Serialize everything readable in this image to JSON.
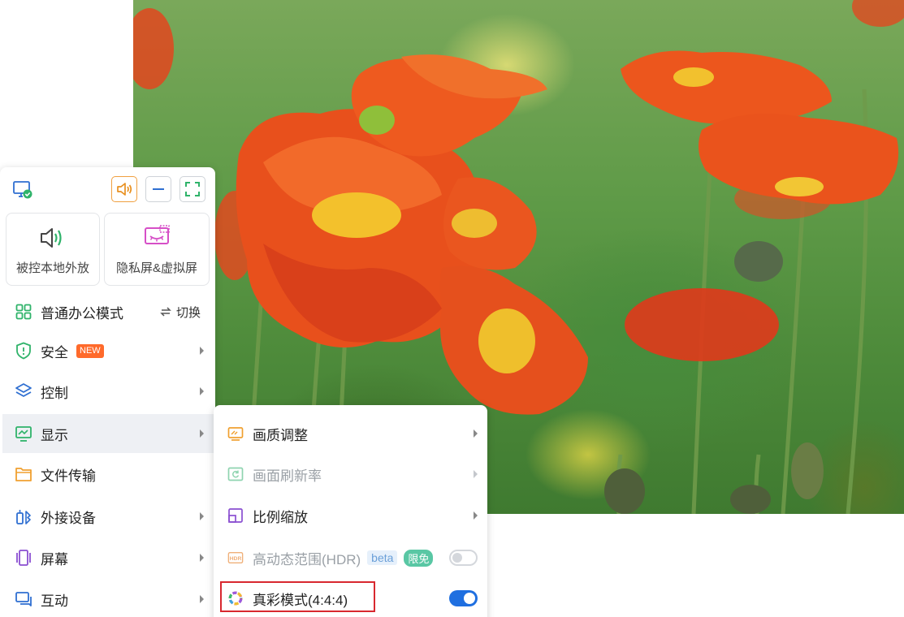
{
  "colors": {
    "accent_blue": "#1f6fe0",
    "accent_green": "#2fb36a",
    "accent_orange": "#ff6a2b",
    "highlight_red": "#d8282f"
  },
  "toolbar": {
    "icons": [
      "monitor-check-icon",
      "speaker-icon",
      "minimize-icon",
      "fullscreen-icon"
    ]
  },
  "tiles": [
    {
      "label": "被控本地外放",
      "icon": "speaker-icon"
    },
    {
      "label": "隐私屏&虚拟屏",
      "icon": "privacy-screen-icon"
    }
  ],
  "menu": {
    "mode": {
      "label": "普通办公模式",
      "switch_label": "切换",
      "icon": "grid-icon"
    },
    "items": [
      {
        "label": "安全",
        "badge": "NEW",
        "icon": "shield-icon",
        "has_arrow": true
      },
      {
        "label": "控制",
        "icon": "layers-icon",
        "has_arrow": true
      },
      {
        "label": "显示",
        "icon": "monitor-chart-icon",
        "has_arrow": true,
        "active": true
      },
      {
        "label": "文件传输",
        "icon": "folder-icon",
        "has_arrow": false
      },
      {
        "label": "外接设备",
        "icon": "devices-icon",
        "has_arrow": true
      },
      {
        "label": "屏幕",
        "icon": "screen-icon",
        "has_arrow": true
      },
      {
        "label": "互动",
        "icon": "chat-icon",
        "has_arrow": true
      }
    ]
  },
  "submenu": {
    "items": [
      {
        "label": "画质调整",
        "icon": "picture-quality-icon",
        "has_arrow": true,
        "disabled": false
      },
      {
        "label": "画面刷新率",
        "icon": "refresh-rate-icon",
        "has_arrow": true,
        "disabled": true
      },
      {
        "label": "比例缩放",
        "icon": "scale-icon",
        "has_arrow": true,
        "disabled": false
      },
      {
        "label": "高动态范围(HDR)",
        "icon": "hdr-icon",
        "tag_beta": "beta",
        "tag_free": "限免",
        "toggle": false,
        "disabled": true
      },
      {
        "label": "真彩模式(4:4:4)",
        "icon": "color-wheel-icon",
        "toggle": true,
        "disabled": false
      }
    ]
  }
}
